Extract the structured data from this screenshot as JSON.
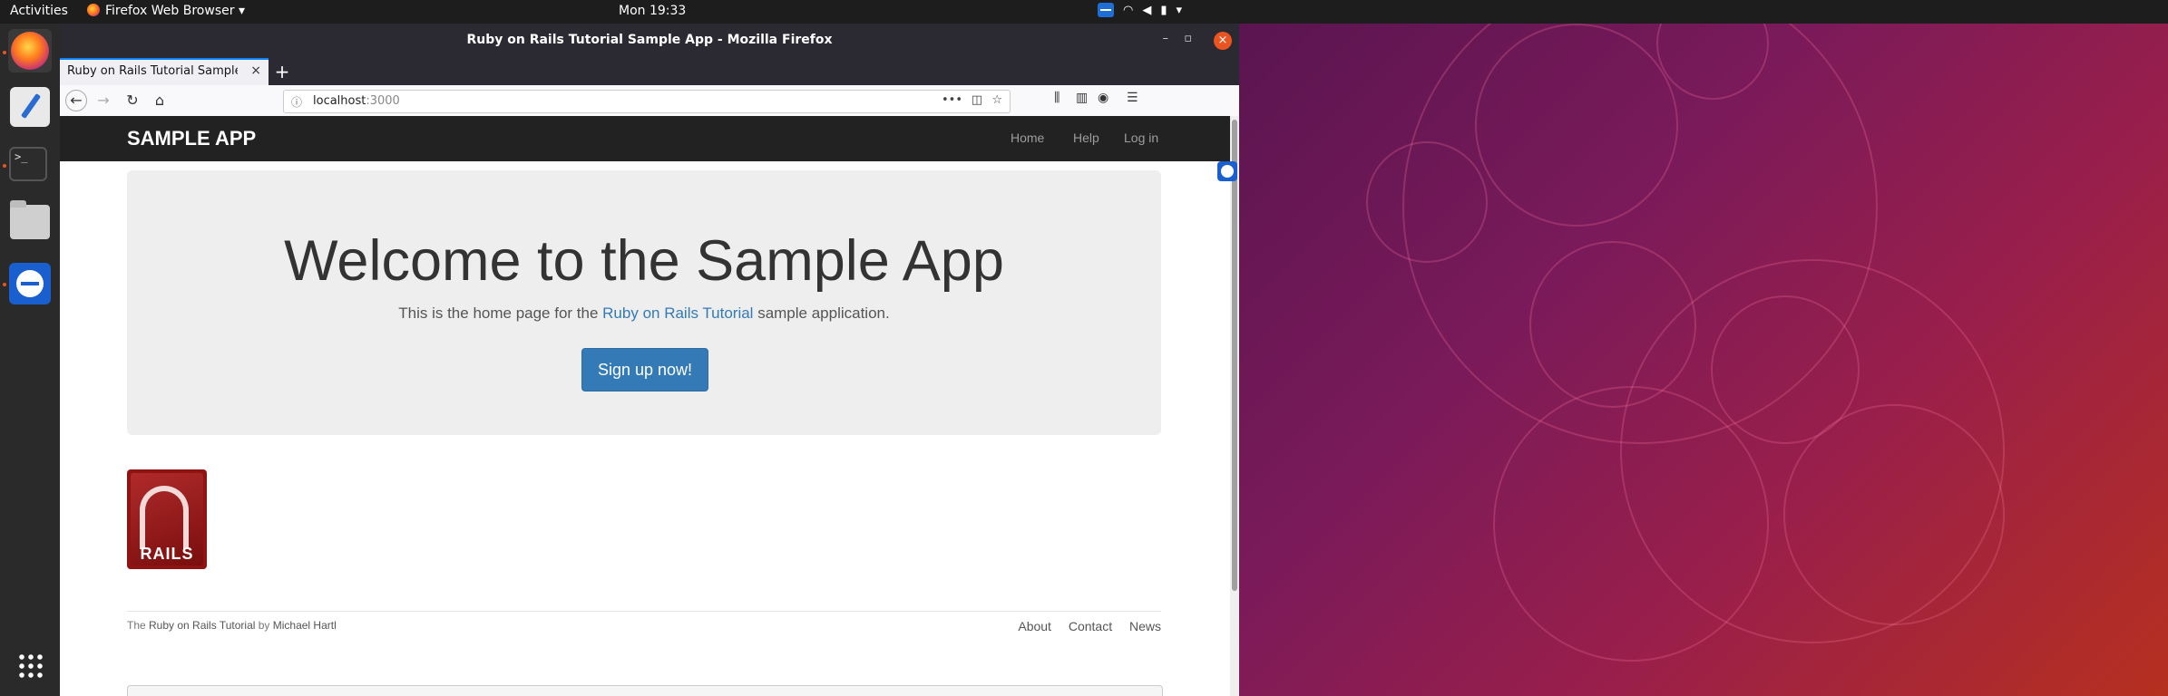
{
  "topbar": {
    "activities": "Activities",
    "app_menu": "Firefox Web Browser",
    "clock": "Mon 19:33"
  },
  "window": {
    "title": "Ruby on Rails Tutorial Sample App - Mozilla Firefox"
  },
  "tab": {
    "label": "Ruby on Rails Tutorial Sample App"
  },
  "address": {
    "host": "localhost",
    "port": ":3000"
  },
  "site": {
    "logo": "SAMPLE APP",
    "nav": [
      "Home",
      "Help",
      "Log in"
    ],
    "heading": "Welcome to the Sample App",
    "sub_before": "This is the home page for the ",
    "sub_link": "Ruby on Rails Tutorial",
    "sub_after": " sample application.",
    "signup": "Sign up now!",
    "rails_logo_text": "RAILS",
    "footer_the": "The ",
    "footer_link": "Ruby on Rails Tutorial",
    "footer_by": " by ",
    "footer_author": "Michael Hartl",
    "footer_links": [
      "About",
      "Contact",
      "News"
    ]
  },
  "colors": {
    "accent": "#337ab7",
    "navbar": "#222222",
    "ubuntu_orange": "#e95420"
  }
}
